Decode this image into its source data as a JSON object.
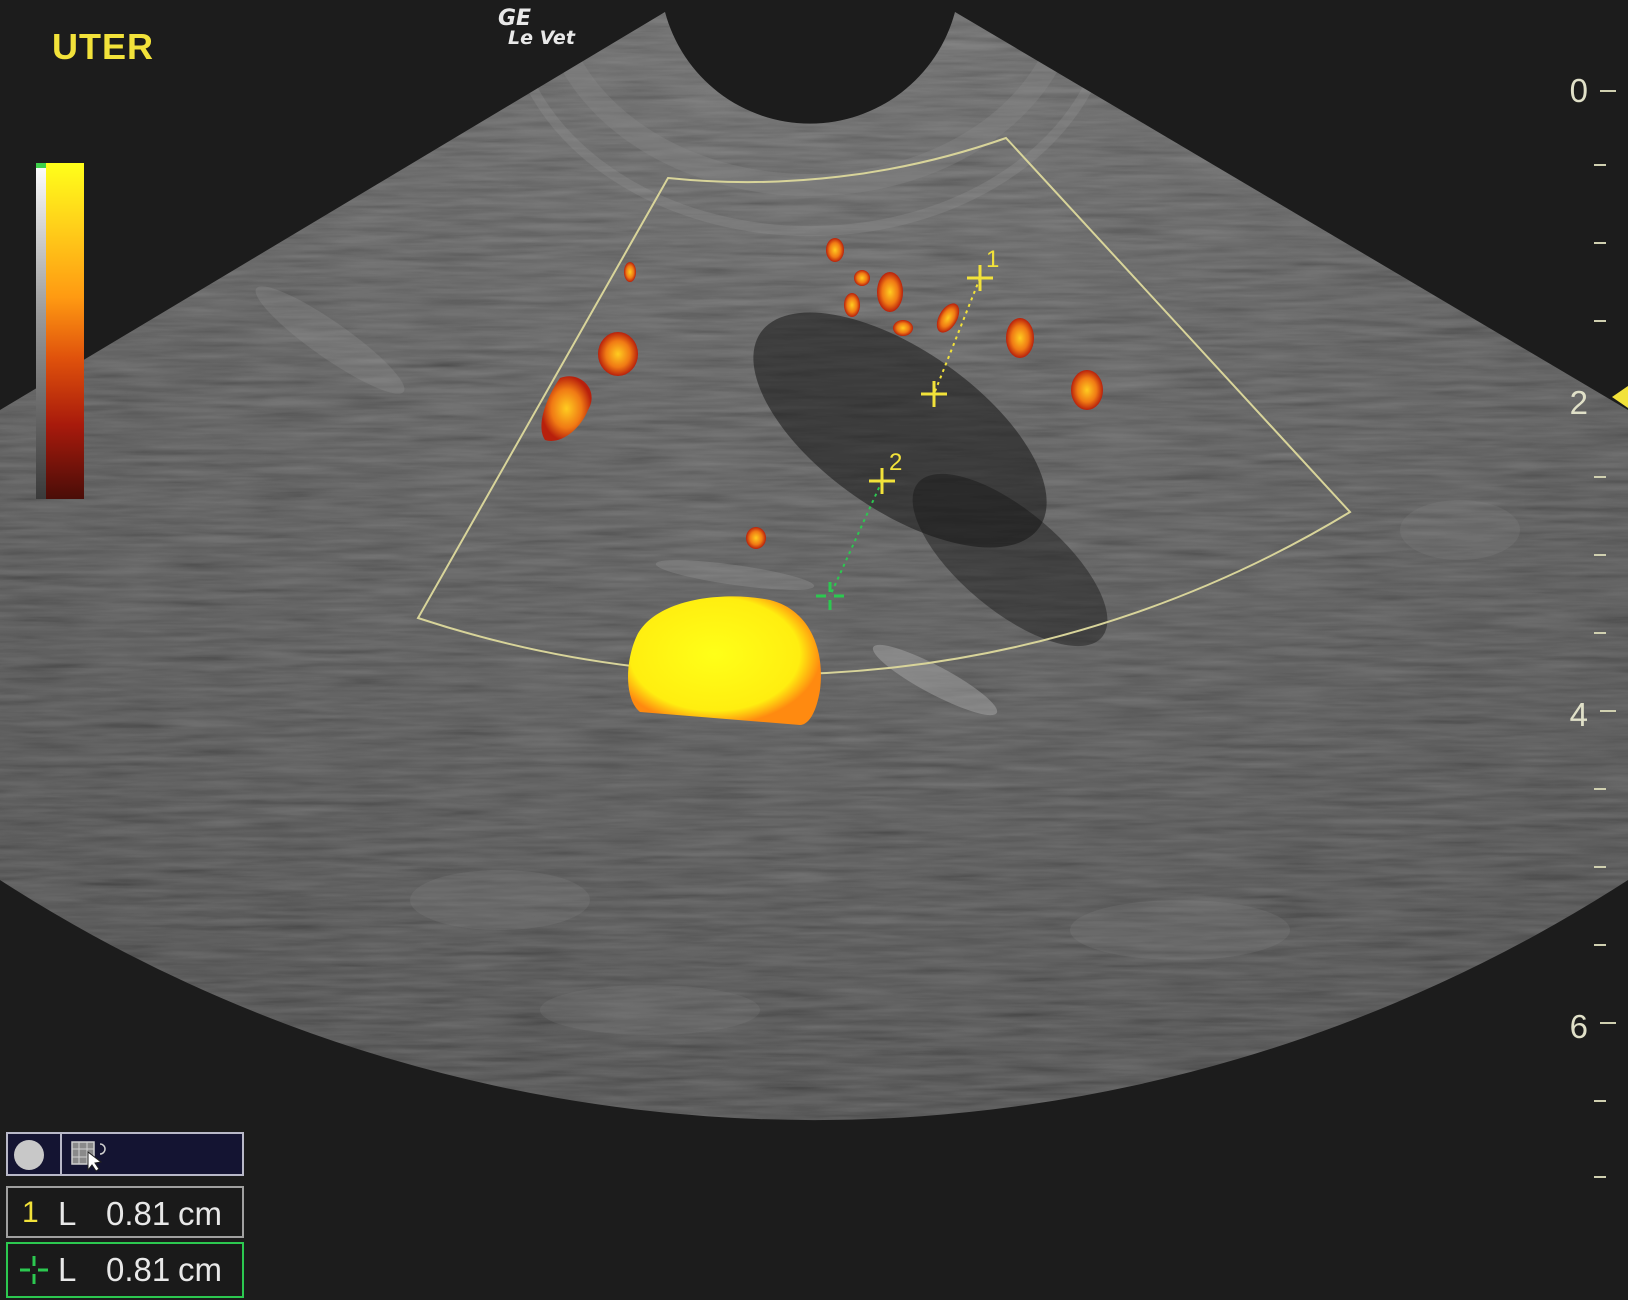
{
  "header": {
    "preset": "UTER",
    "logo_line1": "GE",
    "logo_line2": "Le Vet"
  },
  "depth_scale": {
    "labels": [
      "0",
      "2",
      "4",
      "6"
    ],
    "unit": "cm",
    "focus_marker_depth": 2
  },
  "colors": {
    "annotation_yellow": "#f2e23a",
    "caliper_green": "#2cc850",
    "background": "#1c1c1c"
  },
  "calipers": {
    "first_label": "1",
    "second_label": "2"
  },
  "toolbar": {
    "icons": [
      "circle-icon",
      "grid-cursor-icon"
    ]
  },
  "measurements": [
    {
      "index": "1",
      "type": "L",
      "value": "0.81",
      "unit": "cm"
    },
    {
      "index": "",
      "type": "L",
      "value": "0.81",
      "unit": "cm"
    }
  ]
}
